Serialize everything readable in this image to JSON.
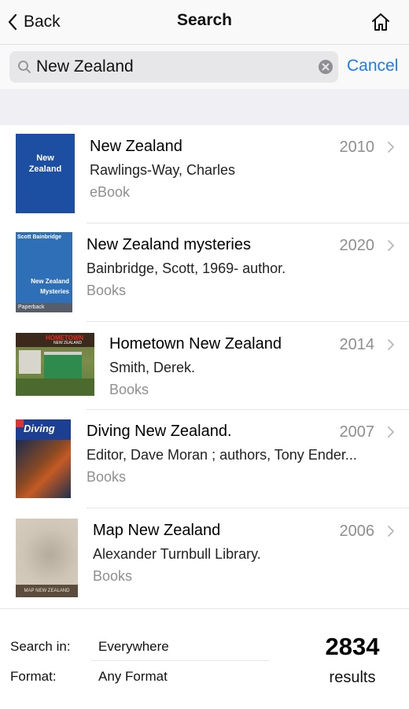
{
  "nav": {
    "back_label": "Back",
    "title": "Search"
  },
  "search": {
    "value": "New Zealand",
    "cancel_label": "Cancel"
  },
  "results": [
    {
      "title": "New Zealand",
      "author": "Rawlings-Way, Charles",
      "format": "eBook",
      "year": "2010",
      "cover_text": {
        "line1": "New",
        "line2": "Zealand"
      }
    },
    {
      "title": "New Zealand mysteries",
      "author": "Bainbridge, Scott, 1969- author.",
      "format": "Books",
      "year": "2020",
      "cover_text": {
        "top": "Scott Bainbridge",
        "mid1": "New Zealand",
        "mid2": "Mysteries",
        "bottom": "Paperback"
      }
    },
    {
      "title": "Hometown New Zealand",
      "author": "Smith, Derek.",
      "format": "Books",
      "year": "2014",
      "cover_text": {
        "line1": "HOMETOWN",
        "line2": "NEW ZEALAND"
      }
    },
    {
      "title": "Diving New Zealand.",
      "author": "Editor, Dave Moran ; authors, Tony Ender...",
      "format": "Books",
      "year": "2007",
      "cover_text": {
        "logo": "Diving"
      }
    },
    {
      "title": "Map New Zealand",
      "author": "Alexander Turnbull Library.",
      "format": "Books",
      "year": "2006",
      "cover_text": {
        "label": "MAP NEW ZEALAND"
      }
    }
  ],
  "footer": {
    "search_in_label": "Search in:",
    "search_in_value": "Everywhere",
    "format_label": "Format:",
    "format_value": "Any Format",
    "count": "2834",
    "count_label": "results"
  },
  "colors": {
    "accent": "#1b7cf7",
    "secondary_text": "#8e8e93",
    "group_bg": "#efeff4"
  },
  "icons": [
    "chevron-left-icon",
    "home-icon",
    "search-icon",
    "clear-icon",
    "chevron-right-icon"
  ]
}
